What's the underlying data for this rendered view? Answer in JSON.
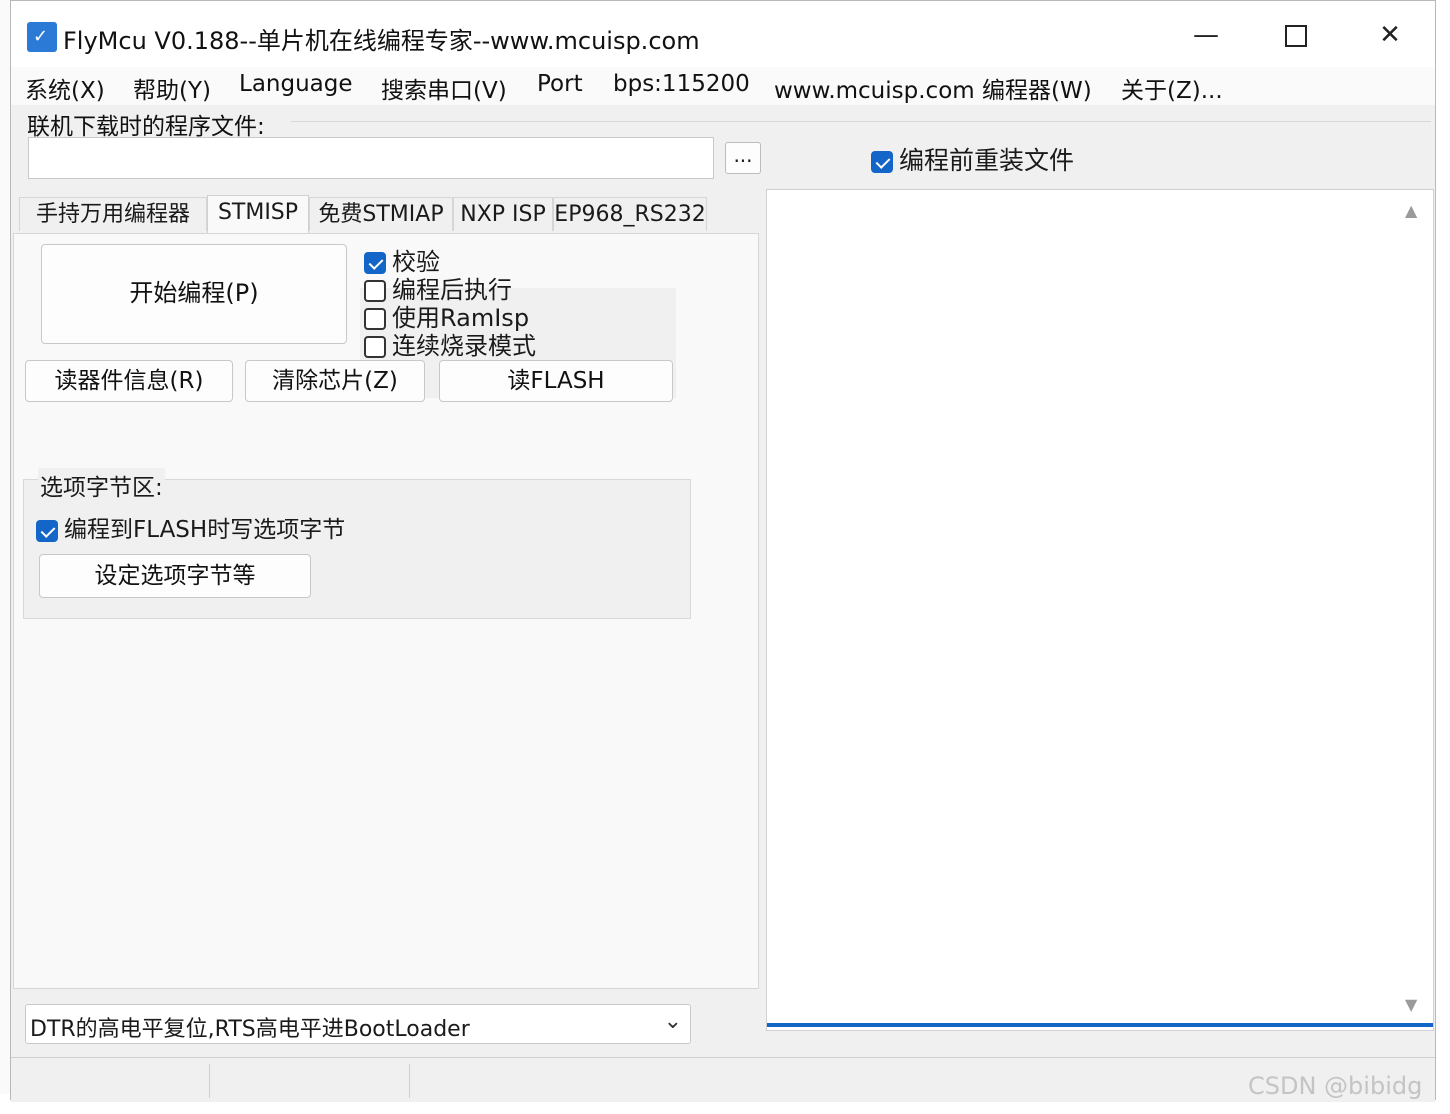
{
  "window": {
    "title": "FlyMcu V0.188--单片机在线编程专家--www.mcuisp.com",
    "minimize": "—",
    "close": "✕"
  },
  "menu": [
    "系统(X)",
    "帮助(Y)",
    "Language",
    "搜索串口(V)",
    "Port",
    "bps:115200",
    "www.mcuisp.com 编程器(W)",
    "关于(Z)..."
  ],
  "file": {
    "label": "联机下载时的程序文件:",
    "value": "",
    "browse_label": "...",
    "reload_label": "编程前重装文件",
    "reload_checked": true
  },
  "tabs": [
    "手持万用编程器",
    "STMISP",
    "免费STMIAP",
    "NXP ISP",
    "EP968_RS232"
  ],
  "active_tab": "STMISP",
  "actions": {
    "start": "开始编程(P)",
    "read_info": "读器件信息(R)",
    "erase": "清除芯片(Z)",
    "read_flash": "读FLASH"
  },
  "options": [
    {
      "label": "校验",
      "checked": true
    },
    {
      "label": "编程后执行",
      "checked": false
    },
    {
      "label": "使用RamIsp",
      "checked": false
    },
    {
      "label": "连续烧录模式",
      "checked": false
    }
  ],
  "option_bytes": {
    "title": "选项字节区:",
    "write_label": "编程到FLASH时写选项字节",
    "write_checked": true,
    "set_button": "设定选项字节等"
  },
  "boot_mode": {
    "selected": "DTR的高电平复位,RTS高电平进BootLoader"
  },
  "watermark": "CSDN @bibidg",
  "icons": [
    "app-icon",
    "minimize-icon",
    "maximize-icon",
    "close-icon",
    "chevron-down-icon",
    "scroll-up-icon",
    "scroll-down-icon",
    "checkmark-icon"
  ],
  "colors": {
    "accent": "#1366c8",
    "window_bg": "#f0f0f0",
    "panel_bg": "#f9f9f9"
  }
}
